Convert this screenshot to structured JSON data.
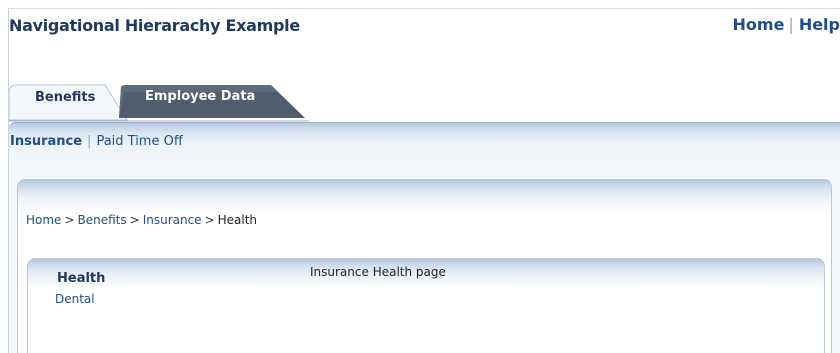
{
  "header": {
    "title": "Navigational Hierarachy Example",
    "links": {
      "home": "Home",
      "separator": "|",
      "help": "Help"
    }
  },
  "tabs": [
    {
      "label": "Benefits",
      "selected": true
    },
    {
      "label": "Employee Data",
      "selected": false
    }
  ],
  "subnav": {
    "items": [
      {
        "label": "Insurance",
        "selected": true
      },
      {
        "label": "Paid Time Off",
        "selected": false
      }
    ],
    "separator": "|"
  },
  "breadcrumb": {
    "items": [
      "Home",
      "Benefits",
      "Insurance"
    ],
    "current": "Health",
    "separator": ">"
  },
  "side_nav": {
    "items": [
      {
        "label": "Health",
        "selected": true
      },
      {
        "label": "Dental",
        "selected": false
      }
    ]
  },
  "content": {
    "text": "Insurance Health page"
  },
  "colors": {
    "title": "#1f3a5c",
    "link": "#1f4e88",
    "inactive_tab": "#4f5d6e",
    "panel_top": "#b7c8de"
  }
}
